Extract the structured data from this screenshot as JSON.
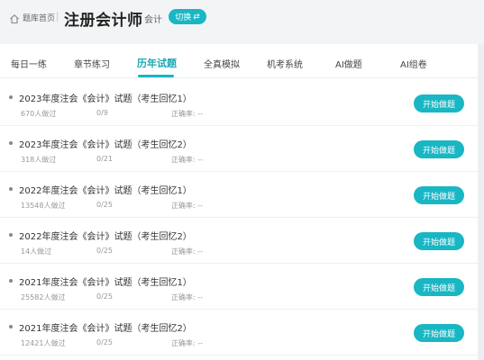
{
  "header": {
    "home_label": "题库首页",
    "title": "注册会计师",
    "subject": "会计",
    "switch_label": "切换",
    "switch_icon": "⇄"
  },
  "tabs": [
    {
      "label": "每日一练"
    },
    {
      "label": "章节练习"
    },
    {
      "label": "历年试题",
      "active": true
    },
    {
      "label": "全真模拟"
    },
    {
      "label": "机考系统"
    },
    {
      "label": "AI做题"
    },
    {
      "label": "AI组卷"
    }
  ],
  "papers": [
    {
      "title": "2023年度注会《会计》试题（考生回忆1）",
      "count": "670人做过",
      "progress": "0/9",
      "accuracy": "正确率: --",
      "button": "开始做题"
    },
    {
      "title": "2023年度注会《会计》试题（考生回忆2）",
      "count": "318人做过",
      "progress": "0/21",
      "accuracy": "正确率: --",
      "button": "开始做题"
    },
    {
      "title": "2022年度注会《会计》试题（考生回忆1）",
      "count": "13548人做过",
      "progress": "0/25",
      "accuracy": "正确率: --",
      "button": "开始做题"
    },
    {
      "title": "2022年度注会《会计》试题（考生回忆2）",
      "count": "14人做过",
      "progress": "0/25",
      "accuracy": "正确率: --",
      "button": "开始做题"
    },
    {
      "title": "2021年度注会《会计》试题（考生回忆1）",
      "count": "25582人做过",
      "progress": "0/25",
      "accuracy": "正确率: --",
      "button": "开始做题"
    },
    {
      "title": "2021年度注会《会计》试题（考生回忆2）",
      "count": "12421人做过",
      "progress": "0/25",
      "accuracy": "正确率: --",
      "button": "开始做题"
    }
  ],
  "colors": {
    "accent": "#19b6c4",
    "background": "#f3f4f6"
  }
}
